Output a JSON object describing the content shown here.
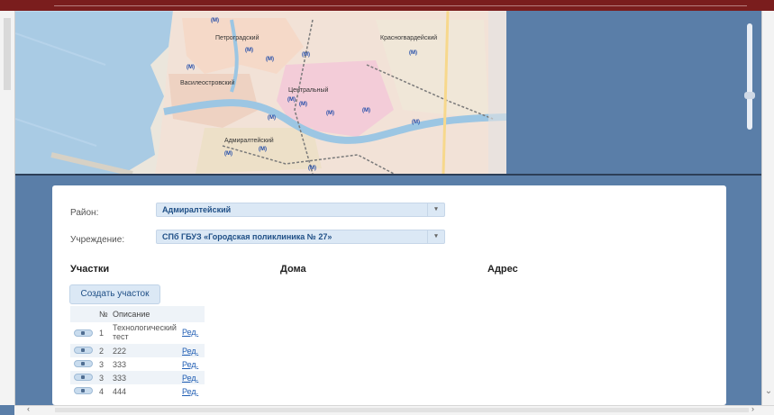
{
  "map": {
    "districts": [
      "Петроградский",
      "Красногвардейский",
      "Василеостровский",
      "Центральный",
      "Адмиралтейский"
    ],
    "metro_glyph": "(M)"
  },
  "form": {
    "district_label": "Район:",
    "district_value": "Адмиралтейский",
    "institution_label": "Учреждение:",
    "institution_value": "СПб ГБУЗ «Городская поликлиника № 27»",
    "dropdown_arrow": "▾"
  },
  "columns": {
    "uchastki": "Участки",
    "doma": "Дома",
    "adres": "Адрес"
  },
  "create_button": "Создать участок",
  "table": {
    "headers": {
      "num": "№",
      "desc": "Описание"
    },
    "rows": [
      {
        "num": "1",
        "desc_line1": "Технологический",
        "desc_line2": "тест",
        "edit": "Ред."
      },
      {
        "num": "2",
        "desc_line1": "222",
        "desc_line2": "",
        "edit": "Ред."
      },
      {
        "num": "3",
        "desc_line1": "333",
        "desc_line2": "",
        "edit": "Ред."
      },
      {
        "num": "3",
        "desc_line1": "333",
        "desc_line2": "",
        "edit": "Ред."
      },
      {
        "num": "4",
        "desc_line1": "444",
        "desc_line2": "",
        "edit": "Ред."
      }
    ]
  },
  "scroll": {
    "left_arrow": "‹",
    "right_arrow": "›",
    "down_arrow": "⌄"
  }
}
